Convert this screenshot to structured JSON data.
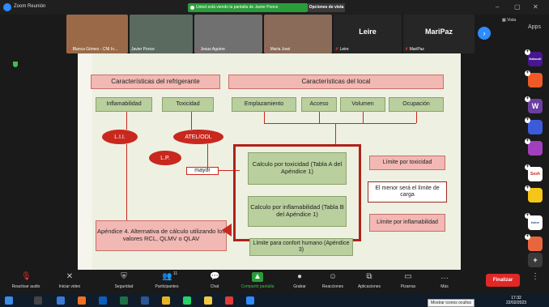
{
  "window": {
    "title": "Zoom Reunión",
    "share_banner": "Usted está viendo la pantalla de Javier Ponce",
    "view_options": "Opciones de vista",
    "minimize": "–",
    "restore": "▢",
    "close": "✕"
  },
  "gallery": {
    "participants": [
      {
        "name": "Blanca Gómez - CNI In...",
        "muted": true,
        "bg": "#8a5a3a"
      },
      {
        "name": "Javier Ponce",
        "muted": false,
        "bg": "#4a5a4a"
      },
      {
        "name": "Jesus Aguirre",
        "muted": true,
        "bg": "#6a6a6a"
      },
      {
        "name": "María José",
        "muted": true,
        "bg": "#7a5a48"
      },
      {
        "name": "Leire",
        "muted": true,
        "bg": "#252525",
        "big": "Leire"
      },
      {
        "name": "MariPaz",
        "muted": true,
        "bg": "#252525",
        "big": "MariPaz"
      }
    ],
    "vista": "Vista",
    "apps": "Apps"
  },
  "right_apps": [
    {
      "label": "Kahoot!",
      "color": "#46178f"
    },
    {
      "label": "",
      "color": "#f05a28"
    },
    {
      "label": "W",
      "color": "#6b3fa0"
    },
    {
      "label": "",
      "color": "#3b5bdb"
    },
    {
      "label": "",
      "color": "#a23fbd"
    },
    {
      "label": "Sesh",
      "color": "#ffffff"
    },
    {
      "label": "",
      "color": "#f5c518"
    },
    {
      "label": "twine",
      "color": "#ffffff"
    },
    {
      "label": "",
      "color": "#e8663d"
    },
    {
      "label": "+",
      "color": "#3a3a3a"
    }
  ],
  "slide": {
    "refrigerante": "Características del refrigerante",
    "local": "Características del local",
    "inflamabilidad": "Inflamabilidad",
    "toxicidad": "Toxicidad",
    "emplazamiento": "Emplazamiento",
    "acceso": "Acceso",
    "volumen": "Volumen",
    "ocupacion": "Ocupación",
    "lii": "L.I.I.",
    "atel": "ATEL/ODL",
    "lp": "L.P.",
    "mayor": "mayor",
    "calc_tox": "Calculo por toxicidad (Tabla A del Apéndice 1)",
    "calc_infl": "Calculo por inflamabilidad (Tabla B del Apéndice 1)",
    "limite_tox": "Límite por toxicidad",
    "menor": "El menor será el límite de carga",
    "limite_infl": "Límite por inflamabilidad",
    "apendice4": "Apéndice 4. Alternativa de cálculo utilizando los valores RCL, QLMV o QLAV",
    "confort": "Límite para confort humano (Apéndice 3)"
  },
  "toolbar": {
    "reactivar": "Reactivar audio",
    "video": "Iniciar video",
    "seguridad": "Seguridad",
    "participantes": "Participantes",
    "participantes_count": "11",
    "chat": "Chat",
    "compartir": "Compartir pantalla",
    "grabar": "Grabar",
    "reacciones": "Reacciones",
    "aplicaciones": "Aplicaciones",
    "pizarras": "Pizarras",
    "mas": "Más",
    "finalizar": "Finalizar"
  },
  "taskbar": {
    "time": "17:32",
    "date": "22/02/2023",
    "tooltip": "Mostrar iconos ocultos"
  }
}
